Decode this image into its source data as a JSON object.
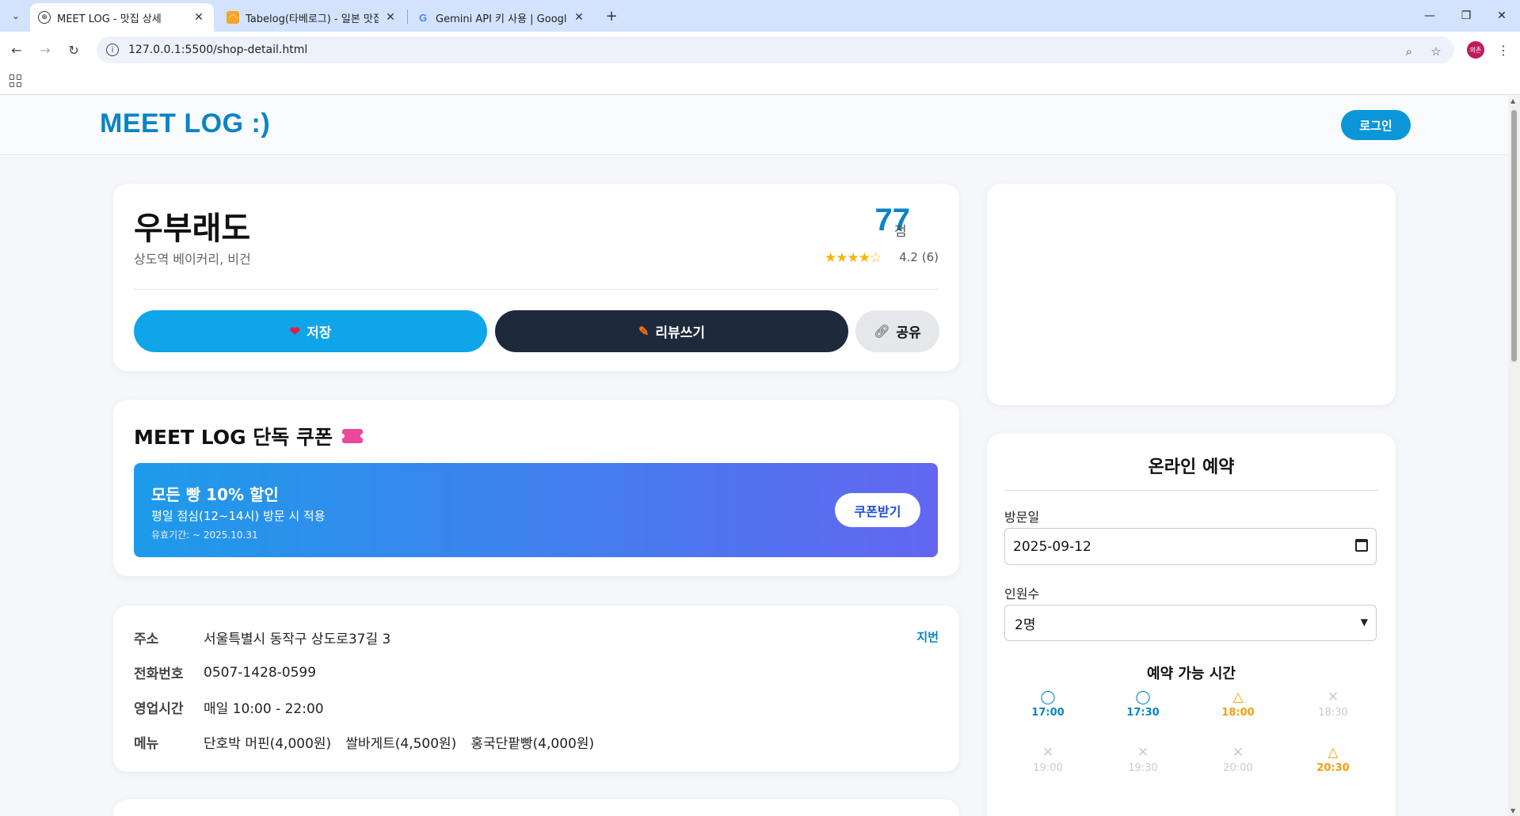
{
  "browser": {
    "tabs": [
      {
        "title": "MEET LOG - 맛집 상세",
        "active": true,
        "icon": "globe-icon"
      },
      {
        "title": "Tabelog(타베로그) - 일본 맛집",
        "active": false,
        "icon": "tabelog-icon"
      },
      {
        "title": "Gemini API 키 사용  |  Google",
        "active": false,
        "icon": "google-icon"
      }
    ],
    "url": "127.0.0.1:5500/shop-detail.html",
    "profile_initials": "의존"
  },
  "header": {
    "logo": "MEET LOG :)",
    "login_label": "로그인"
  },
  "shop": {
    "name": "우부래도",
    "subtitle": "상도역 베이커리, 비건",
    "score": "77",
    "score_unit": "점",
    "stars": "★★★★☆",
    "rating_text": "4.2 (6)",
    "save_label": "저장",
    "review_label": "리뷰쓰기",
    "share_label": "공유"
  },
  "coupon": {
    "section_title": "MEET LOG 단독 쿠폰",
    "title": "모든 빵 10% 할인",
    "condition": "평일 점심(12~14시) 방문 시 적용",
    "expiry": "유효기간: ~ 2025.10.31",
    "button_label": "쿠폰받기"
  },
  "info": {
    "address_label": "주소",
    "address": "서울특별시 동작구 상도로37길 3",
    "jibun_label": "지번",
    "phone_label": "전화번호",
    "phone": "0507-1428-0599",
    "hours_label": "영업시간",
    "hours": "매일 10:00 - 22:00",
    "menu_label": "메뉴",
    "menu_items": [
      "단호박 머핀(4,000원)",
      "쌀바게트(4,500원)",
      "홍국단팥빵(4,000원)"
    ]
  },
  "reservation": {
    "title": "온라인 예약",
    "date_label": "방문일",
    "date_value": "2025-09-12",
    "people_label": "인원수",
    "people_value": "2명",
    "slots_title": "예약 가능 시간",
    "slots": [
      {
        "time": "17:00",
        "status": "available",
        "symbol": "◯"
      },
      {
        "time": "17:30",
        "status": "available",
        "symbol": "◯"
      },
      {
        "time": "18:00",
        "status": "few",
        "symbol": "△"
      },
      {
        "time": "18:30",
        "status": "full",
        "symbol": "✕"
      },
      {
        "time": "19:00",
        "status": "full",
        "symbol": "✕"
      },
      {
        "time": "19:30",
        "status": "full",
        "symbol": "✕"
      },
      {
        "time": "20:00",
        "status": "full",
        "symbol": "✕"
      },
      {
        "time": "20:30",
        "status": "few",
        "symbol": "△"
      }
    ]
  },
  "colors": {
    "brand": "#0a84c6",
    "save": "#0ea5e9",
    "review": "#1e293b",
    "few": "#f59e0b",
    "full": "#c8ccd2"
  }
}
